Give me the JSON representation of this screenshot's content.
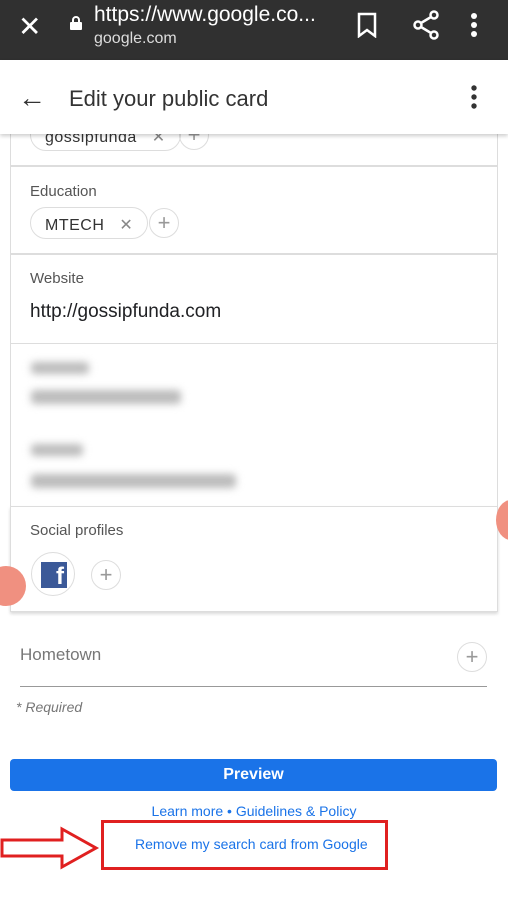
{
  "browser": {
    "url": "https://www.google.co...",
    "domain": "google.com"
  },
  "header": {
    "title": "Edit your public card"
  },
  "cards": {
    "previous_chip": "gossipfunda",
    "education": {
      "label": "Education",
      "chip": "MTECH"
    },
    "website": {
      "label": "Website",
      "value": "http://gossipfunda.com"
    },
    "social": {
      "label": "Social profiles",
      "icon": "facebook-icon"
    }
  },
  "hometown": {
    "placeholder": "Hometown"
  },
  "required_note": "* Required",
  "preview_label": "Preview",
  "links": {
    "learn_more": "Learn more",
    "separator": " • ",
    "guidelines": "Guidelines & Policy",
    "remove": "Remove my search card from Google"
  },
  "colors": {
    "accent": "#1a73e8",
    "highlight": "#e02020",
    "facebook": "#3b5998"
  }
}
